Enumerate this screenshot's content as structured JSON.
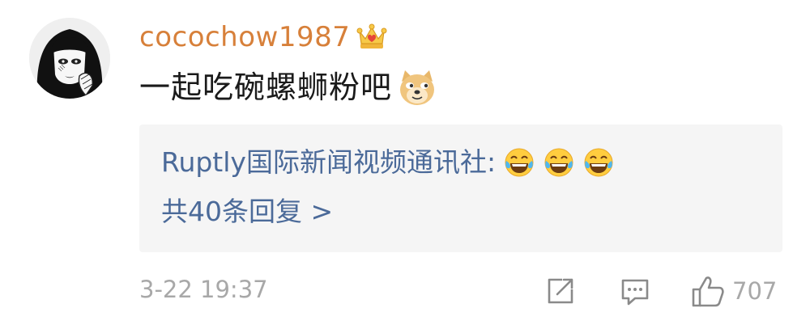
{
  "comment": {
    "username": "cocochow1987",
    "badge_icon": "crown-icon",
    "text": "一起吃碗螺蛳粉吧",
    "text_emoji": "doge-emoji",
    "username_color": "#d7803a"
  },
  "reply_preview": {
    "author": "Ruptly国际新闻视频通讯社:",
    "emojis": [
      "laughing-crying-emoji",
      "laughing-crying-emoji",
      "laughing-crying-emoji"
    ],
    "count_label": "共40条回复 >",
    "link_color": "#4b6a99"
  },
  "meta": {
    "timestamp": "3-22 19:37",
    "like_count": "707"
  },
  "actions": {
    "share_icon": "share-icon",
    "comment_icon": "comment-icon",
    "like_icon": "thumbs-up-icon"
  }
}
